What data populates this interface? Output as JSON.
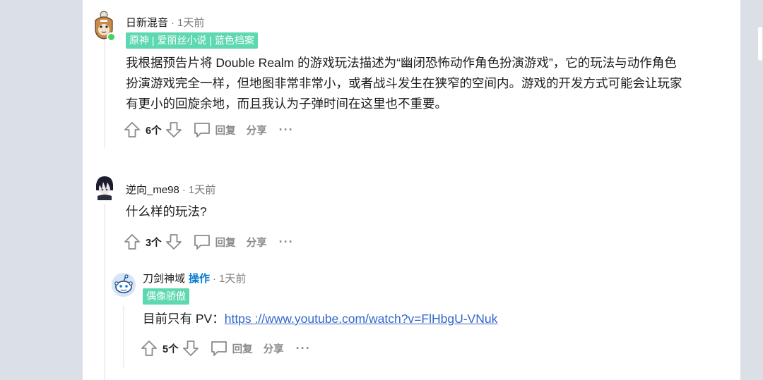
{
  "comments": [
    {
      "username": "日新混音",
      "separator": "·",
      "time": "1天前",
      "flair": "原神 | 爱丽丝小说 | 蓝色档案",
      "text_lines": [
        "我根据预告片将 Double Realm 的游戏玩法描述为“幽闭恐怖动作角色扮演游戏”，它的玩法与动作角色",
        "扮演游戏完全一样，但地图非常非常小，或者战斗发生在狭窄的空间内。游戏的开发方式可能会让玩家",
        "有更小的回旋余地，而且我认为子弹时间在这里也不重要。"
      ],
      "votes": "6个",
      "reply_label": "回复",
      "share_label": "分享",
      "more_label": "···"
    },
    {
      "username": "逆向_me98",
      "separator": "·",
      "time": "1天前",
      "text": "什么样的玩法?",
      "votes": "3个",
      "reply_label": "回复",
      "share_label": "分享",
      "more_label": "···"
    },
    {
      "username": "刀剑神域",
      "op_label": "操作",
      "separator": "·",
      "time": "1天前",
      "flair": "偶像骄傲",
      "text_prefix": "目前只有 PV：",
      "link_text": "https ://www.youtube.com/watch?v=FlHbgU-VNuk",
      "votes": "5个",
      "reply_label": "回复",
      "share_label": "分享",
      "more_label": "···"
    }
  ],
  "colors": {
    "background": "#dae0e6",
    "panel": "#ffffff",
    "flair": "#5ed8b0",
    "op": "#0079d3",
    "link": "#3366cc",
    "online": "#46d160"
  },
  "icons": [
    "upvote-icon",
    "downvote-icon",
    "comment-bubble-icon",
    "more-icon"
  ]
}
